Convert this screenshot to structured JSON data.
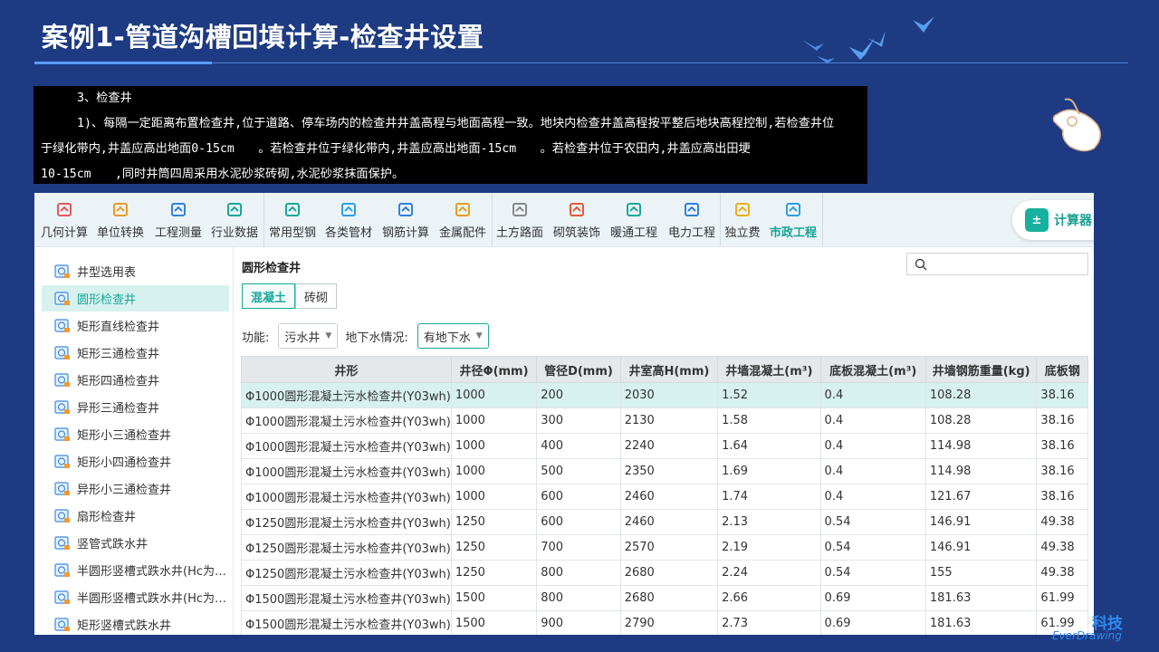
{
  "slide": {
    "title": "案例1-管道沟槽回填计算-检查井设置"
  },
  "note": {
    "line1": "3、检查井",
    "line2": "1)、每隔一定距离布置检查井,位于道路、停车场内的检查井井盖高程与地面高程一致。地块内检查井盖高程按平整后地块高程控制,若检查井位",
    "line3": "于绿化带内,井盖应高出地面0-15cm　　。若检查井位于绿化带内,井盖应高出地面-15cm　　。若检查井位于农田内,井盖应高出田埂",
    "line4": "10-15cm　　,同时井筒四周采用水泥砂浆砖砌,水泥砂浆抹面保护。"
  },
  "toolbar": {
    "items": [
      {
        "label": "几何计算",
        "icon": "cube-icon",
        "color": "#e05a5a"
      },
      {
        "label": "单位转换",
        "icon": "unit-convert-icon",
        "color": "#e89a2a"
      },
      {
        "label": "工程测量",
        "icon": "survey-axis-icon",
        "color": "#2f7fe0"
      },
      {
        "label": "行业数据",
        "icon": "bar-chart-icon",
        "color": "#1aa699"
      },
      {
        "label": "常用型钢",
        "icon": "tools-icon",
        "color": "#1aa699"
      },
      {
        "label": "各类管材",
        "icon": "pipe-icon",
        "color": "#2f9fe0"
      },
      {
        "label": "钢筋计算",
        "icon": "rebar-icon",
        "color": "#2f7fe0"
      },
      {
        "label": "金属配件",
        "icon": "fitting-icon",
        "color": "#e0a020"
      },
      {
        "label": "土方路面",
        "icon": "road-icon",
        "color": "#888888"
      },
      {
        "label": "砌筑装饰",
        "icon": "brick-icon",
        "color": "#e05a3a"
      },
      {
        "label": "暖通工程",
        "icon": "fan-icon",
        "color": "#1aa699"
      },
      {
        "label": "电力工程",
        "icon": "house-pulse-icon",
        "color": "#2f7fe0"
      },
      {
        "label": "独立费",
        "icon": "fee-chart-icon",
        "color": "#e8b020"
      },
      {
        "label": "市政工程",
        "icon": "hydrant-icon",
        "color": "#2f9fe0"
      }
    ],
    "calculator_label": "计算器"
  },
  "sidebar": {
    "items": [
      "井型选用表",
      "圆形检查井",
      "矩形直线检查井",
      "矩形三通检查井",
      "矩形四通检查井",
      "异形三通检查井",
      "矩形小三通检查井",
      "矩形小四通检查井",
      "异形小三通检查井",
      "扇形检查井",
      "竖管式跌水井",
      "半圆形竖槽式跌水井(Hc为…",
      "半圆形竖槽式跌水井(Hc为…",
      "矩形竖槽式跌水井"
    ],
    "active_index": 1
  },
  "panel": {
    "title": "圆形检查井",
    "tabs": [
      "混凝土",
      "砖砌"
    ],
    "active_tab": 0,
    "function_label": "功能:",
    "function_value": "污水井",
    "groundwater_label": "地下水情况:",
    "groundwater_value": "有地下水"
  },
  "table": {
    "columns": [
      "井形",
      "井径Φ(mm)",
      "管径D(mm)",
      "井室高H(mm)",
      "井墙混凝土(m³)",
      "底板混凝土(m³)",
      "井墙钢筋重量(kg)",
      "底板钢"
    ],
    "rows": [
      [
        "Φ1000圆形混凝土污水检查井(Y03wh)",
        "1000",
        "200",
        "2030",
        "1.52",
        "0.4",
        "108.28",
        "38.16"
      ],
      [
        "Φ1000圆形混凝土污水检查井(Y03wh)",
        "1000",
        "300",
        "2130",
        "1.58",
        "0.4",
        "108.28",
        "38.16"
      ],
      [
        "Φ1000圆形混凝土污水检查井(Y03wh)",
        "1000",
        "400",
        "2240",
        "1.64",
        "0.4",
        "114.98",
        "38.16"
      ],
      [
        "Φ1000圆形混凝土污水检查井(Y03wh)",
        "1000",
        "500",
        "2350",
        "1.69",
        "0.4",
        "114.98",
        "38.16"
      ],
      [
        "Φ1000圆形混凝土污水检查井(Y03wh)",
        "1000",
        "600",
        "2460",
        "1.74",
        "0.4",
        "121.67",
        "38.16"
      ],
      [
        "Φ1250圆形混凝土污水检查井(Y03wh)",
        "1250",
        "600",
        "2460",
        "2.13",
        "0.54",
        "146.91",
        "49.38"
      ],
      [
        "Φ1250圆形混凝土污水检查井(Y03wh)",
        "1250",
        "700",
        "2570",
        "2.19",
        "0.54",
        "146.91",
        "49.38"
      ],
      [
        "Φ1250圆形混凝土污水检查井(Y03wh)",
        "1250",
        "800",
        "2680",
        "2.24",
        "0.54",
        "155",
        "49.38"
      ],
      [
        "Φ1500圆形混凝土污水检查井(Y03wh)",
        "1500",
        "800",
        "2680",
        "2.66",
        "0.69",
        "181.63",
        "61.99"
      ],
      [
        "Φ1500圆形混凝土污水检查井(Y03wh)",
        "1500",
        "900",
        "2790",
        "2.73",
        "0.69",
        "181.63",
        "61.99"
      ]
    ],
    "selected_row": 0
  },
  "brand": {
    "name_cn": "科技",
    "name_en": "EverDrawing"
  }
}
